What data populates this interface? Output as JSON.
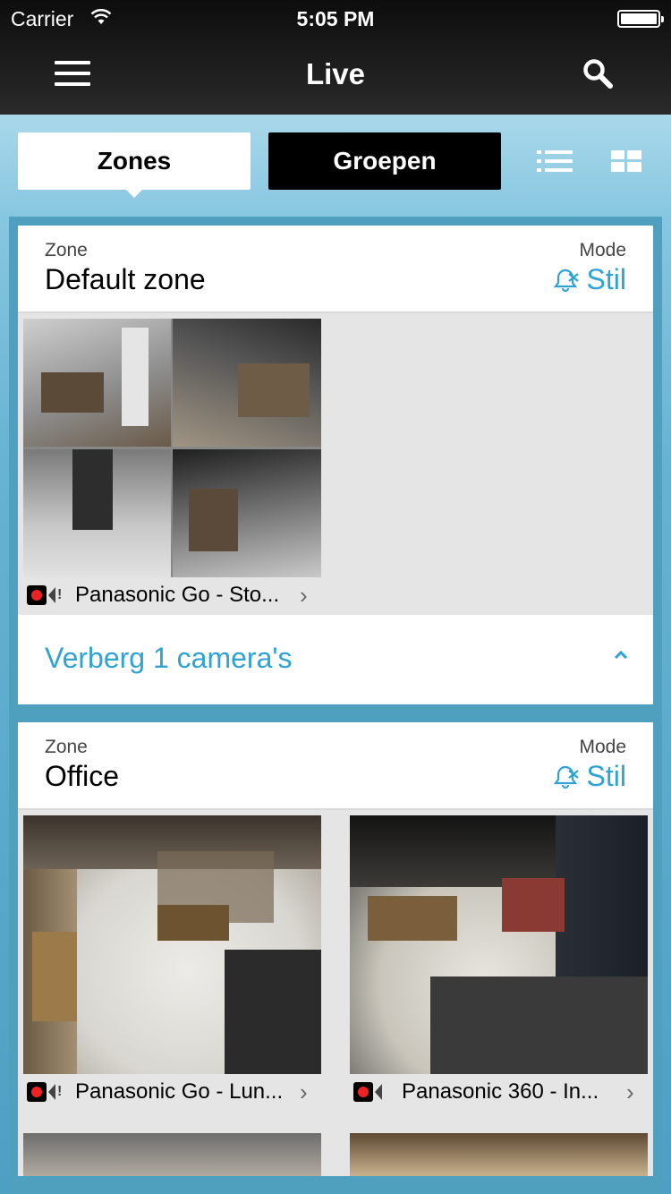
{
  "status_bar": {
    "carrier": "Carrier",
    "time": "5:05 PM"
  },
  "nav": {
    "title": "Live"
  },
  "segments": {
    "zones": "Zones",
    "groups": "Groepen"
  },
  "zones": [
    {
      "label": "Zone",
      "name": "Default zone",
      "mode_label": "Mode",
      "mode_value": "Stil",
      "cameras": [
        {
          "name": "Panasonic Go - Sto...",
          "recording": true
        }
      ],
      "toggle_text": "Verberg 1 camera's"
    },
    {
      "label": "Zone",
      "name": "Office",
      "mode_label": "Mode",
      "mode_value": "Stil",
      "cameras": [
        {
          "name": "Panasonic Go - Lun...",
          "recording": true
        },
        {
          "name": "Panasonic 360 - In...",
          "recording": true
        }
      ]
    }
  ],
  "colors": {
    "accent": "#2fa3d3",
    "navbar": "#1a1a1a",
    "background": "#4f9fbf"
  }
}
